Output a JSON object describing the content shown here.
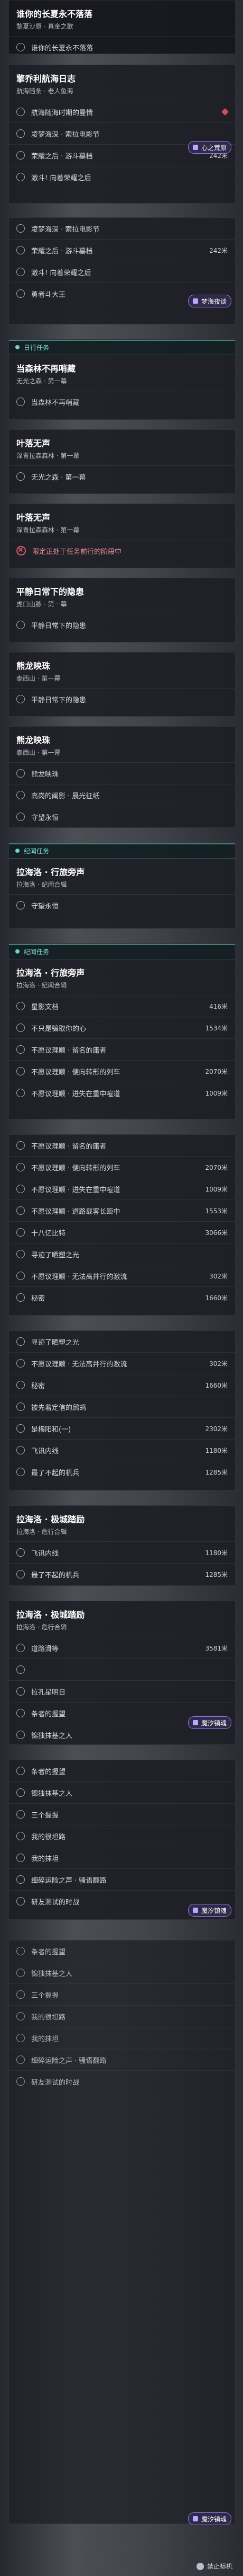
{
  "accent": "#6fd3c8",
  "danger": "#d34a58",
  "badges": {
    "b1": "心之荒原",
    "b2": "梦海夜谈",
    "b3": "魔汐镇魂",
    "b4": "魔汐镇魂",
    "b5": "魔汐镇魂"
  },
  "panel1": {
    "title": "谁你的长夏永不落落",
    "subtitle": "黎夏沙原 · 真金之歌",
    "item": "谁你的长夏永不落落"
  },
  "panel2": {
    "title": "擎乔利航海日志",
    "subtitle": "航海随条 · 老人鱼海",
    "items": [
      {
        "label": "航海随海时期的曼情",
        "dist": ""
      },
      {
        "label": "凌梦海深 · 索拉电影节",
        "dist": ""
      },
      {
        "label": "荣耀之后 · 游斗墓档",
        "dist": "242米"
      },
      {
        "label": "激斗! 向着荣耀之后",
        "dist": ""
      }
    ]
  },
  "panel3": {
    "items": [
      {
        "label": "凌梦海深 · 索拉电影节",
        "dist": ""
      },
      {
        "label": "荣耀之后 · 游斗墓档",
        "dist": "242米"
      },
      {
        "label": "激斗! 向着荣耀之后",
        "dist": ""
      },
      {
        "label": "勇者斗大王",
        "dist": ""
      }
    ]
  },
  "block4": {
    "section": "日行任务",
    "title": "当森林不再哨藏",
    "subtitle": "无光之森 · 第一幕",
    "item": "当森林不再哨藏"
  },
  "block5": {
    "title": "叶落无声",
    "subtitle": "深青拉森森林 · 第一幕",
    "item": "无光之森 · 第一幕"
  },
  "block6": {
    "title": "叶落无声",
    "subtitle": "深青拉森森林 · 第一幕",
    "item": "限定正处于任务前行的阶段中"
  },
  "block7": {
    "title": "平静日常下的隐患",
    "subtitle": "虎口山脉 · 第一幕",
    "item": "平静日常下的隐患"
  },
  "block8": {
    "title": "熊龙映珠",
    "subtitle": "泰西山 · 第一幕",
    "item": "平静日常下的隐患"
  },
  "block9": {
    "title": "熊龙映珠",
    "subtitle": "泰西山 · 第一幕",
    "items": [
      "熊龙映珠",
      "高岗的阐影 · 晨光征纸",
      "守望永恒"
    ]
  },
  "block10": {
    "section": "纪闻任务",
    "title": "拉海洛 · 行旅旁声",
    "subtitle": "拉海洛 · 纪闻合辑",
    "item": "守望永恒"
  },
  "block11": {
    "section": "纪闻任务",
    "title": "拉海洛 · 行旅旁声",
    "subtitle": "拉海洛 · 纪闻合辑",
    "items": [
      {
        "label": "星影文档",
        "dist": "416米"
      },
      {
        "label": "不只是骗取你的心",
        "dist": "1534米"
      },
      {
        "label": "不愿议理顺 · 留名的庸者",
        "dist": ""
      },
      {
        "label": "不愿议理顺 · 便向转形的列车",
        "dist": "2070米"
      },
      {
        "label": "不愿议理顺 · 进失在重中喧道",
        "dist": "1009米"
      }
    ]
  },
  "block12": {
    "items": [
      {
        "label": "不愿议理顺 · 留名的庸者",
        "dist": ""
      },
      {
        "label": "不愿议理顺 · 便向转形的列车",
        "dist": "2070米"
      },
      {
        "label": "不愿议理顺 · 进失在重中喧道",
        "dist": "1009米"
      },
      {
        "label": "不愿议理顺 · 道路载客长距中",
        "dist": "1553米"
      },
      {
        "label": "十八亿比特",
        "dist": "3066米"
      },
      {
        "label": "寻迹了晒塑之光",
        "dist": ""
      },
      {
        "label": "不愿议理顺 · 无法高并行的激流",
        "dist": "302米"
      },
      {
        "label": "秘密",
        "dist": "1660米"
      }
    ]
  },
  "block13": {
    "items": [
      {
        "label": "寻迹了晒塑之光",
        "dist": ""
      },
      {
        "label": "不愿议理顺 · 无法高并行的激流",
        "dist": "302米"
      },
      {
        "label": "秘密",
        "dist": "1660米"
      },
      {
        "label": "被先着定信的鹧鸪",
        "dist": ""
      },
      {
        "label": "是梅阳和(一)",
        "dist": "2302米"
      },
      {
        "label": "飞讯内线",
        "dist": "1180米"
      },
      {
        "label": "最了不起的机兵",
        "dist": "1285米"
      }
    ]
  },
  "block14": {
    "title": "拉海洛 · 极城踏励",
    "subtitle": "拉海洛 · 危行合辑",
    "items": [
      {
        "label": "飞讯内线",
        "dist": "1180米"
      },
      {
        "label": "最了不起的机兵",
        "dist": "1285米"
      }
    ]
  },
  "block15": {
    "title": "拉海洛 · 极城踏励",
    "subtitle": "拉海洛 · 危行合辑",
    "items": [
      {
        "label": "道路滑等",
        "dist": "3581米"
      },
      {
        "label": "",
        "dist": ""
      },
      {
        "label": "拉孔星明日",
        "dist": ""
      },
      {
        "label": "条者的握望",
        "dist": ""
      },
      {
        "label": "锦独抹基之人",
        "dist": ""
      }
    ]
  },
  "block16": {
    "items": [
      {
        "label": "条者的握望",
        "dist": ""
      },
      {
        "label": "锦独抹基之人",
        "dist": ""
      },
      {
        "label": "三个握握",
        "dist": ""
      },
      {
        "label": "我的很坦路",
        "dist": ""
      },
      {
        "label": "我的抹坦",
        "dist": ""
      },
      {
        "label": "细碎运险之声 · 骚语翻路",
        "dist": ""
      },
      {
        "label": "研友测试的时战",
        "dist": ""
      }
    ]
  },
  "watermark": "禁止标机"
}
